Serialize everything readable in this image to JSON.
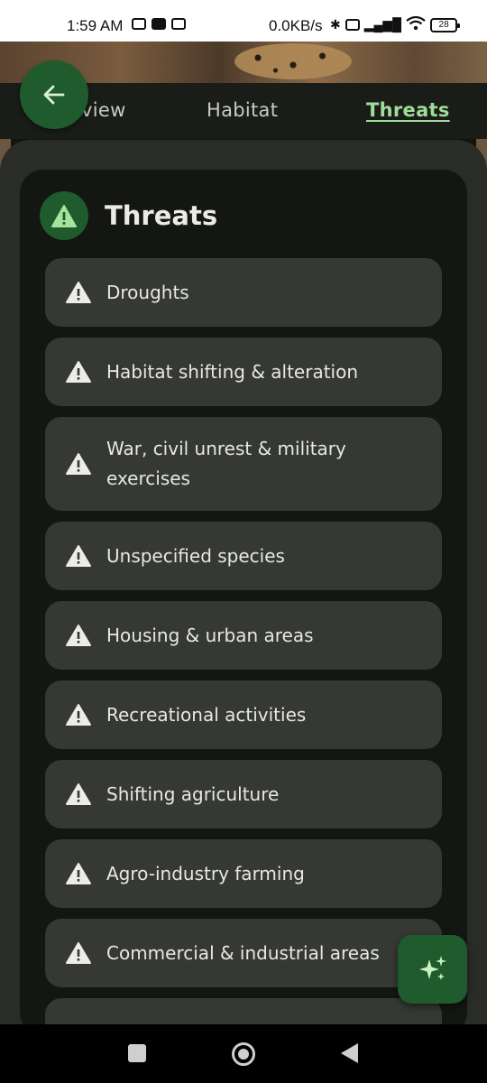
{
  "status_bar": {
    "time": "1:59 AM",
    "network_speed": "0.0KB/s",
    "battery": "28",
    "icons_left": [
      "twitch-icon",
      "youtube-icon",
      "sim-icon"
    ],
    "icons_right": [
      "bluetooth-icon",
      "volte-icon",
      "signal-icon",
      "wifi-icon",
      "battery-icon"
    ]
  },
  "tabs": {
    "overview": "view",
    "habitat": "Habitat",
    "threats": "Threats",
    "active": "Threats"
  },
  "card": {
    "title": "Threats",
    "icon": "warning-icon"
  },
  "threats": [
    "Droughts",
    "Habitat shifting & alteration",
    "War, civil unrest & military exercises",
    "Unspecified species",
    "Housing & urban areas",
    "Recreational activities",
    "Shifting agriculture",
    "Agro-industry farming",
    "Commercial & industrial areas"
  ],
  "colors": {
    "accent_green": "#1f5b2c",
    "active_tab": "#9fdb9a",
    "item_bg": "#363833",
    "card_bg": "#141613",
    "sheet_bg": "#2a2c27"
  },
  "fab_icon": "sparkle-icon",
  "back_icon": "arrow-left-icon"
}
